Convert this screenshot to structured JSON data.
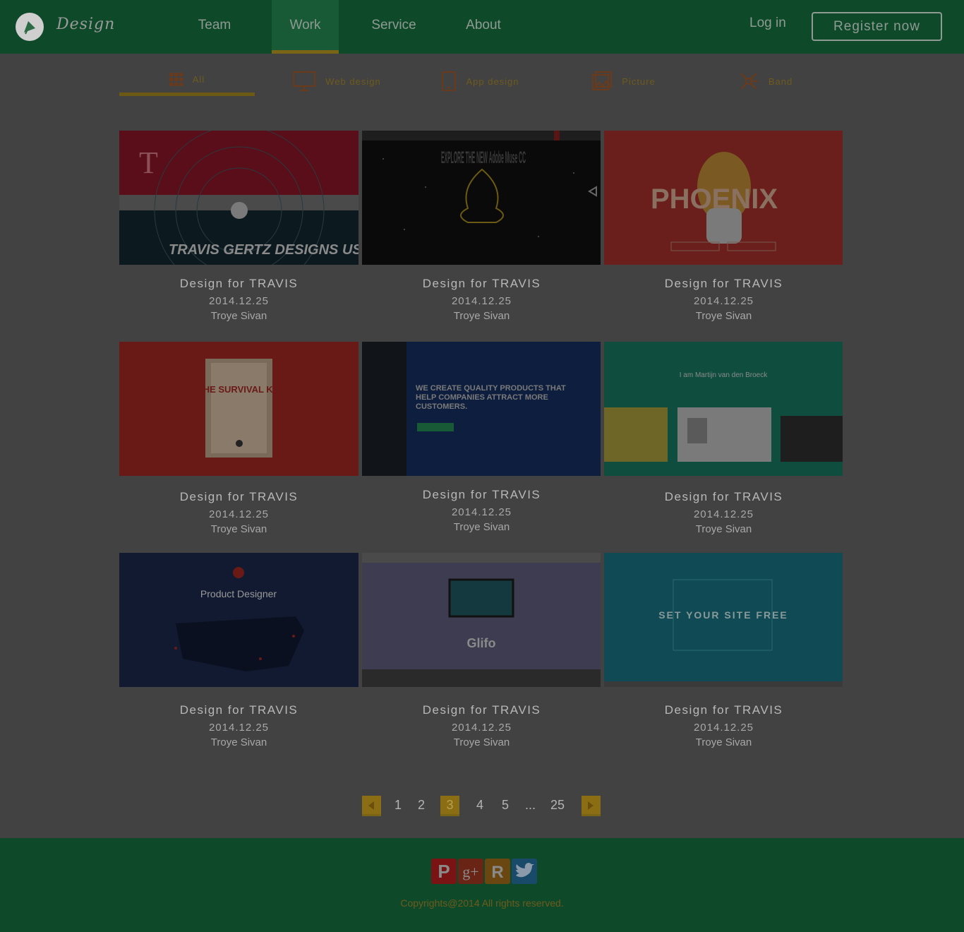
{
  "header": {
    "brand": "Design",
    "nav": [
      "Team",
      "Work",
      "Service",
      "About"
    ],
    "active_nav": "Work",
    "login": "Log in",
    "register": "Register now"
  },
  "categories": [
    "All",
    "Web design",
    "App design",
    "Picture",
    "Band"
  ],
  "active_category": "All",
  "cards": [
    {
      "title": "Design for TRAVIS",
      "date": "2014.12.25",
      "author": "Troye Sivan",
      "thumb_text": "TRAVIS GERTZ DESIGNS USER"
    },
    {
      "title": "Design for TRAVIS",
      "date": "2014.12.25",
      "author": "Troye Sivan",
      "thumb_text": "EXPLORE THE NEW Adobe Muse CC"
    },
    {
      "title": "Design for TRAVIS",
      "date": "2014.12.25",
      "author": "Troye Sivan",
      "thumb_text": "PHOENIX"
    },
    {
      "title": "Design for TRAVIS",
      "date": "2014.12.25",
      "author": "Troye Sivan",
      "thumb_text": "THE SURVIVAL KIT"
    },
    {
      "title": "Design for TRAVIS",
      "date": "2014.12.25",
      "author": "Troye Sivan",
      "thumb_text": "WE CREATE QUALITY PRODUCTS THAT HELP COMPANIES ATTRACT MORE CUSTOMERS."
    },
    {
      "title": "Design for TRAVIS",
      "date": "2014.12.25",
      "author": "Troye Sivan",
      "thumb_text": "I am Martijn van den Broeck"
    },
    {
      "title": "Design for TRAVIS",
      "date": "2014.12.25",
      "author": "Troye Sivan",
      "thumb_text": "Product Designer"
    },
    {
      "title": "Design for TRAVIS",
      "date": "2014.12.25",
      "author": "Troye Sivan",
      "thumb_text": "Glifo"
    },
    {
      "title": "Design for TRAVIS",
      "date": "2014.12.25",
      "author": "Troye Sivan",
      "thumb_text": "SET YOUR SITE FREE"
    }
  ],
  "pagination": {
    "pages": [
      "1",
      "2",
      "3",
      "4",
      "5",
      "...",
      "25"
    ],
    "current": "3"
  },
  "footer": {
    "copyright": "Copyrights@2014 All rights reserved."
  },
  "colors": {
    "header_bg": "#0e4a2a",
    "accent": "#7a6516",
    "body_bg": "#424242"
  }
}
